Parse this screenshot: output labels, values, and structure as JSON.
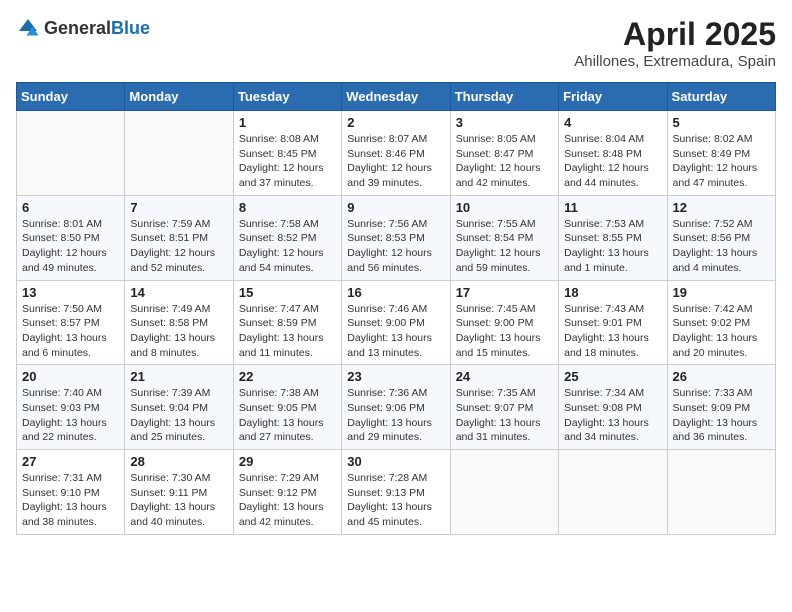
{
  "header": {
    "logo_general": "General",
    "logo_blue": "Blue",
    "month_title": "April 2025",
    "location": "Ahillones, Extremadura, Spain"
  },
  "days_of_week": [
    "Sunday",
    "Monday",
    "Tuesday",
    "Wednesday",
    "Thursday",
    "Friday",
    "Saturday"
  ],
  "weeks": [
    [
      {
        "day": "",
        "detail": ""
      },
      {
        "day": "",
        "detail": ""
      },
      {
        "day": "1",
        "detail": "Sunrise: 8:08 AM\nSunset: 8:45 PM\nDaylight: 12 hours\nand 37 minutes."
      },
      {
        "day": "2",
        "detail": "Sunrise: 8:07 AM\nSunset: 8:46 PM\nDaylight: 12 hours\nand 39 minutes."
      },
      {
        "day": "3",
        "detail": "Sunrise: 8:05 AM\nSunset: 8:47 PM\nDaylight: 12 hours\nand 42 minutes."
      },
      {
        "day": "4",
        "detail": "Sunrise: 8:04 AM\nSunset: 8:48 PM\nDaylight: 12 hours\nand 44 minutes."
      },
      {
        "day": "5",
        "detail": "Sunrise: 8:02 AM\nSunset: 8:49 PM\nDaylight: 12 hours\nand 47 minutes."
      }
    ],
    [
      {
        "day": "6",
        "detail": "Sunrise: 8:01 AM\nSunset: 8:50 PM\nDaylight: 12 hours\nand 49 minutes."
      },
      {
        "day": "7",
        "detail": "Sunrise: 7:59 AM\nSunset: 8:51 PM\nDaylight: 12 hours\nand 52 minutes."
      },
      {
        "day": "8",
        "detail": "Sunrise: 7:58 AM\nSunset: 8:52 PM\nDaylight: 12 hours\nand 54 minutes."
      },
      {
        "day": "9",
        "detail": "Sunrise: 7:56 AM\nSunset: 8:53 PM\nDaylight: 12 hours\nand 56 minutes."
      },
      {
        "day": "10",
        "detail": "Sunrise: 7:55 AM\nSunset: 8:54 PM\nDaylight: 12 hours\nand 59 minutes."
      },
      {
        "day": "11",
        "detail": "Sunrise: 7:53 AM\nSunset: 8:55 PM\nDaylight: 13 hours\nand 1 minute."
      },
      {
        "day": "12",
        "detail": "Sunrise: 7:52 AM\nSunset: 8:56 PM\nDaylight: 13 hours\nand 4 minutes."
      }
    ],
    [
      {
        "day": "13",
        "detail": "Sunrise: 7:50 AM\nSunset: 8:57 PM\nDaylight: 13 hours\nand 6 minutes."
      },
      {
        "day": "14",
        "detail": "Sunrise: 7:49 AM\nSunset: 8:58 PM\nDaylight: 13 hours\nand 8 minutes."
      },
      {
        "day": "15",
        "detail": "Sunrise: 7:47 AM\nSunset: 8:59 PM\nDaylight: 13 hours\nand 11 minutes."
      },
      {
        "day": "16",
        "detail": "Sunrise: 7:46 AM\nSunset: 9:00 PM\nDaylight: 13 hours\nand 13 minutes."
      },
      {
        "day": "17",
        "detail": "Sunrise: 7:45 AM\nSunset: 9:00 PM\nDaylight: 13 hours\nand 15 minutes."
      },
      {
        "day": "18",
        "detail": "Sunrise: 7:43 AM\nSunset: 9:01 PM\nDaylight: 13 hours\nand 18 minutes."
      },
      {
        "day": "19",
        "detail": "Sunrise: 7:42 AM\nSunset: 9:02 PM\nDaylight: 13 hours\nand 20 minutes."
      }
    ],
    [
      {
        "day": "20",
        "detail": "Sunrise: 7:40 AM\nSunset: 9:03 PM\nDaylight: 13 hours\nand 22 minutes."
      },
      {
        "day": "21",
        "detail": "Sunrise: 7:39 AM\nSunset: 9:04 PM\nDaylight: 13 hours\nand 25 minutes."
      },
      {
        "day": "22",
        "detail": "Sunrise: 7:38 AM\nSunset: 9:05 PM\nDaylight: 13 hours\nand 27 minutes."
      },
      {
        "day": "23",
        "detail": "Sunrise: 7:36 AM\nSunset: 9:06 PM\nDaylight: 13 hours\nand 29 minutes."
      },
      {
        "day": "24",
        "detail": "Sunrise: 7:35 AM\nSunset: 9:07 PM\nDaylight: 13 hours\nand 31 minutes."
      },
      {
        "day": "25",
        "detail": "Sunrise: 7:34 AM\nSunset: 9:08 PM\nDaylight: 13 hours\nand 34 minutes."
      },
      {
        "day": "26",
        "detail": "Sunrise: 7:33 AM\nSunset: 9:09 PM\nDaylight: 13 hours\nand 36 minutes."
      }
    ],
    [
      {
        "day": "27",
        "detail": "Sunrise: 7:31 AM\nSunset: 9:10 PM\nDaylight: 13 hours\nand 38 minutes."
      },
      {
        "day": "28",
        "detail": "Sunrise: 7:30 AM\nSunset: 9:11 PM\nDaylight: 13 hours\nand 40 minutes."
      },
      {
        "day": "29",
        "detail": "Sunrise: 7:29 AM\nSunset: 9:12 PM\nDaylight: 13 hours\nand 42 minutes."
      },
      {
        "day": "30",
        "detail": "Sunrise: 7:28 AM\nSunset: 9:13 PM\nDaylight: 13 hours\nand 45 minutes."
      },
      {
        "day": "",
        "detail": ""
      },
      {
        "day": "",
        "detail": ""
      },
      {
        "day": "",
        "detail": ""
      }
    ]
  ]
}
